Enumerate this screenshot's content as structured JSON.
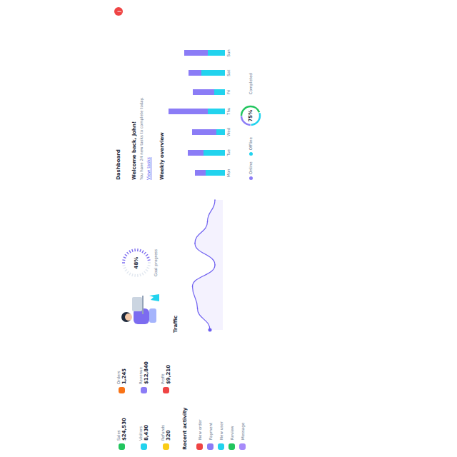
{
  "header": {
    "title": "Dashboard",
    "avatar": "J"
  },
  "welcome": {
    "title": "Welcome back, John!",
    "subtitle": "You have 24 new tasks to complete today.",
    "link": "View tasks"
  },
  "stats": [
    {
      "label": "Sales",
      "value": "$24,530",
      "color": "#22c55e"
    },
    {
      "label": "Orders",
      "value": "1,245",
      "color": "#f97316"
    },
    {
      "label": "Visitors",
      "value": "8,430",
      "color": "#22d3ee"
    },
    {
      "label": "Revenue",
      "value": "$12,840",
      "color": "#8b7cf6"
    },
    {
      "label": "Refunds",
      "value": "320",
      "color": "#facc15"
    },
    {
      "label": "Profit",
      "value": "$9,210",
      "color": "#ef4444"
    }
  ],
  "gauge": {
    "value": "48%",
    "label": "Goal progress",
    "level": 0.48
  },
  "bar_chart": {
    "title": "Weekly overview",
    "labels": [
      "Mon",
      "Tue",
      "Wed",
      "Thu",
      "Fri",
      "Sat",
      "Sun"
    ],
    "series": [
      {
        "name": "Online",
        "color": "#8b7cf6",
        "values": [
          10,
          15,
          23,
          37,
          20,
          12,
          22
        ]
      },
      {
        "name": "Offline",
        "color": "#22d3ee",
        "values": [
          18,
          20,
          8,
          16,
          10,
          22,
          16
        ]
      }
    ]
  },
  "line_chart": {
    "title": "Traffic",
    "values": [
      20,
      45,
      55,
      10,
      50,
      25,
      10
    ]
  },
  "donut": {
    "value": "75%",
    "label": "Completed",
    "segments": [
      {
        "share": 0.45,
        "color": "#22c55e"
      },
      {
        "share": 0.3,
        "color": "#22d3ee"
      },
      {
        "share": 0.25,
        "color": "#8b7cf6"
      }
    ]
  },
  "activity": {
    "title": "Recent activity",
    "items": [
      {
        "label": "New order",
        "color": "#ef4444"
      },
      {
        "label": "Payment",
        "color": "#8b7cf6"
      },
      {
        "label": "New user",
        "color": "#22d3ee"
      },
      {
        "label": "Review",
        "color": "#22c55e"
      },
      {
        "label": "Message",
        "color": "#a78bfa"
      }
    ]
  }
}
